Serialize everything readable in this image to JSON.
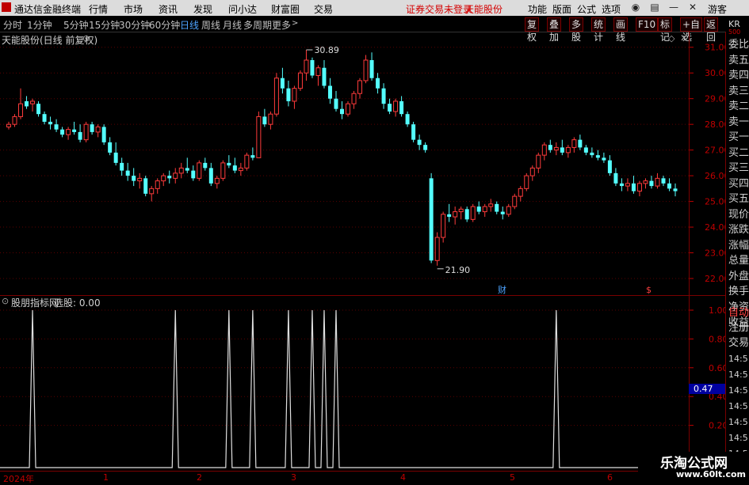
{
  "titlebar": {
    "app_name": "通达信金融终端",
    "menus": [
      "行情",
      "市场",
      "资讯",
      "发现",
      "问小达",
      "财富圈",
      "交易"
    ],
    "notice": "证券交易未登录",
    "stock": "天能股份",
    "right_menus": [
      "功能",
      "版面",
      "公式",
      "选项"
    ],
    "guest": "游客"
  },
  "periodbar": {
    "items": [
      "分时",
      "1分钟",
      "5分钟",
      "15分钟",
      "30分钟",
      "60分钟",
      "日线",
      "周线",
      "月线",
      "多周期",
      "更多"
    ],
    "selected": "日线"
  },
  "toolbar": {
    "buttons": [
      "复权",
      "叠加",
      "多股",
      "统计",
      "画线",
      "F10",
      "标记",
      "+自选",
      "返回"
    ]
  },
  "main_chart": {
    "title": "天能股份(日线 前复权)",
    "y_labels": [
      "31.00",
      "30.00",
      "29.00",
      "28.00",
      "27.00",
      "26.00",
      "25.00",
      "24.00",
      "23.00",
      "22.00"
    ],
    "high_label": "30.89",
    "low_label": "21.90",
    "marker_cai": "财",
    "marker_s": "$"
  },
  "sub_chart": {
    "title": "股朋指标网",
    "indicator": "选股: 0.00",
    "y_labels": [
      "1.00",
      "0.80",
      "0.60",
      "0.40",
      "0.20"
    ],
    "cursor_value": "0.47"
  },
  "right_panel": {
    "items": [
      "委比",
      "卖五",
      "卖四",
      "卖三",
      "卖二",
      "卖一",
      "买一",
      "买二",
      "买三",
      "买四",
      "买五",
      "现价",
      "涨跌",
      "涨幅",
      "总量",
      "外盘",
      "换手",
      "净资",
      "收益",
      "自动",
      "注册",
      "交易",
      "14:5",
      "14:5",
      "14:5",
      "14:5",
      "14:5",
      "14:5",
      "14:5"
    ],
    "header": "KR",
    "header_sub": "500"
  },
  "x_axis": {
    "labels": [
      "2024年",
      "1",
      "2",
      "3",
      "4",
      "5",
      "6"
    ]
  },
  "watermark": {
    "title": "乐淘公式网",
    "url": "www.60lt.com"
  },
  "chart_data": {
    "type": "candlestick",
    "y_range": [
      21.6,
      31.3
    ],
    "candles": [
      [
        27.9,
        28.1,
        27.8,
        28.0
      ],
      [
        28.0,
        28.4,
        27.9,
        28.3
      ],
      [
        28.3,
        29.4,
        28.2,
        28.8
      ],
      [
        28.9,
        29.1,
        28.6,
        28.7
      ],
      [
        28.8,
        29.0,
        28.5,
        28.9
      ],
      [
        28.8,
        28.9,
        28.3,
        28.4
      ],
      [
        28.4,
        28.5,
        28.0,
        28.1
      ],
      [
        28.1,
        28.3,
        27.8,
        28.0
      ],
      [
        28.0,
        28.2,
        27.7,
        27.8
      ],
      [
        27.8,
        27.9,
        27.5,
        27.6
      ],
      [
        27.6,
        27.9,
        27.4,
        27.8
      ],
      [
        27.8,
        28.1,
        27.6,
        27.7
      ],
      [
        27.7,
        28.0,
        27.3,
        27.4
      ],
      [
        27.4,
        28.1,
        27.3,
        28.0
      ],
      [
        28.0,
        28.1,
        27.6,
        27.7
      ],
      [
        27.7,
        28.0,
        27.5,
        27.9
      ],
      [
        27.9,
        28.0,
        27.2,
        27.3
      ],
      [
        27.3,
        27.5,
        26.8,
        26.9
      ],
      [
        26.9,
        27.3,
        26.4,
        26.5
      ],
      [
        26.5,
        26.7,
        26.0,
        26.2
      ],
      [
        26.2,
        26.5,
        25.8,
        26.0
      ],
      [
        26.0,
        26.3,
        25.6,
        25.8
      ],
      [
        25.8,
        26.1,
        25.5,
        25.9
      ],
      [
        25.9,
        26.0,
        25.2,
        25.3
      ],
      [
        25.3,
        25.6,
        25.0,
        25.5
      ],
      [
        25.5,
        25.9,
        25.3,
        25.8
      ],
      [
        25.8,
        26.1,
        25.6,
        26.0
      ],
      [
        26.0,
        26.2,
        25.7,
        25.9
      ],
      [
        25.9,
        26.3,
        25.7,
        26.1
      ],
      [
        26.1,
        26.5,
        25.9,
        26.3
      ],
      [
        26.3,
        26.7,
        26.1,
        26.2
      ],
      [
        26.2,
        26.4,
        25.8,
        25.9
      ],
      [
        25.9,
        26.6,
        25.8,
        26.5
      ],
      [
        26.5,
        26.7,
        26.2,
        26.3
      ],
      [
        26.3,
        26.5,
        25.6,
        25.7
      ],
      [
        25.7,
        26.0,
        25.5,
        25.9
      ],
      [
        25.9,
        26.6,
        25.8,
        26.5
      ],
      [
        26.5,
        26.8,
        26.3,
        26.4
      ],
      [
        26.4,
        26.7,
        26.1,
        26.2
      ],
      [
        26.2,
        26.5,
        26.0,
        26.3
      ],
      [
        26.3,
        26.9,
        26.2,
        26.8
      ],
      [
        26.8,
        27.1,
        26.6,
        26.7
      ],
      [
        26.7,
        28.5,
        26.7,
        28.3
      ],
      [
        28.3,
        28.6,
        27.9,
        28.0
      ],
      [
        28.0,
        28.5,
        27.8,
        28.4
      ],
      [
        28.4,
        30.0,
        28.3,
        29.8
      ],
      [
        29.8,
        30.2,
        29.2,
        29.4
      ],
      [
        29.4,
        29.7,
        28.7,
        28.9
      ],
      [
        28.9,
        29.5,
        28.6,
        29.4
      ],
      [
        29.4,
        30.1,
        29.3,
        30.0
      ],
      [
        30.0,
        30.9,
        29.7,
        30.5
      ],
      [
        30.5,
        30.6,
        29.8,
        29.9
      ],
      [
        29.9,
        30.3,
        29.5,
        30.2
      ],
      [
        30.2,
        30.5,
        29.4,
        29.5
      ],
      [
        29.5,
        29.8,
        28.8,
        29.0
      ],
      [
        29.0,
        29.3,
        28.5,
        28.6
      ],
      [
        28.6,
        28.9,
        28.2,
        28.4
      ],
      [
        28.4,
        28.9,
        28.3,
        28.8
      ],
      [
        28.8,
        29.3,
        28.6,
        29.2
      ],
      [
        29.2,
        29.8,
        29.0,
        29.7
      ],
      [
        29.7,
        30.7,
        29.6,
        30.5
      ],
      [
        30.5,
        30.8,
        29.7,
        29.8
      ],
      [
        29.8,
        30.0,
        29.2,
        29.4
      ],
      [
        29.4,
        29.6,
        28.6,
        28.8
      ],
      [
        28.8,
        29.0,
        28.4,
        28.5
      ],
      [
        28.5,
        29.0,
        28.3,
        28.9
      ],
      [
        28.9,
        29.1,
        28.3,
        28.4
      ],
      [
        28.4,
        28.5,
        27.9,
        28.0
      ],
      [
        28.0,
        28.1,
        27.3,
        27.4
      ],
      [
        27.4,
        27.6,
        27.0,
        27.2
      ],
      [
        27.2,
        27.3,
        26.9,
        27.0
      ],
      [
        25.9,
        26.1,
        22.6,
        22.7
      ],
      [
        22.7,
        23.8,
        22.5,
        23.6
      ],
      [
        23.6,
        24.6,
        23.4,
        24.5
      ],
      [
        24.5,
        24.9,
        24.2,
        24.4
      ],
      [
        24.4,
        24.8,
        24.1,
        24.6
      ],
      [
        24.6,
        24.8,
        24.3,
        24.7
      ],
      [
        24.7,
        24.8,
        24.2,
        24.3
      ],
      [
        24.3,
        24.9,
        24.2,
        24.8
      ],
      [
        24.8,
        25.0,
        24.5,
        24.6
      ],
      [
        24.6,
        24.9,
        24.4,
        24.8
      ],
      [
        24.8,
        25.1,
        24.6,
        24.9
      ],
      [
        24.9,
        25.0,
        24.5,
        24.6
      ],
      [
        24.6,
        24.8,
        24.3,
        24.5
      ],
      [
        24.5,
        24.9,
        24.4,
        24.8
      ],
      [
        24.8,
        25.3,
        24.7,
        25.2
      ],
      [
        25.2,
        25.6,
        25.0,
        25.5
      ],
      [
        25.5,
        26.1,
        25.4,
        26.0
      ],
      [
        26.0,
        26.4,
        25.8,
        26.3
      ],
      [
        26.3,
        26.9,
        26.1,
        26.8
      ],
      [
        26.8,
        27.3,
        26.6,
        27.2
      ],
      [
        27.2,
        27.4,
        26.9,
        27.0
      ],
      [
        27.0,
        27.3,
        26.8,
        27.1
      ],
      [
        27.1,
        27.4,
        26.8,
        26.9
      ],
      [
        26.9,
        27.2,
        26.7,
        27.1
      ],
      [
        27.1,
        27.5,
        26.9,
        27.4
      ],
      [
        27.4,
        27.6,
        27.0,
        27.1
      ],
      [
        27.1,
        27.2,
        26.8,
        26.9
      ],
      [
        26.9,
        27.1,
        26.7,
        26.8
      ],
      [
        26.8,
        27.0,
        26.6,
        26.7
      ],
      [
        26.7,
        26.9,
        26.5,
        26.6
      ],
      [
        26.6,
        26.8,
        26.0,
        26.1
      ],
      [
        26.1,
        26.3,
        25.6,
        25.7
      ],
      [
        25.7,
        25.9,
        25.4,
        25.6
      ],
      [
        25.6,
        25.9,
        25.4,
        25.7
      ],
      [
        25.7,
        26.0,
        25.3,
        25.4
      ],
      [
        25.4,
        25.8,
        25.2,
        25.7
      ],
      [
        25.7,
        25.9,
        25.5,
        25.8
      ],
      [
        25.8,
        26.0,
        25.5,
        25.6
      ],
      [
        25.6,
        26.1,
        25.5,
        25.9
      ],
      [
        25.9,
        26.0,
        25.6,
        25.7
      ],
      [
        25.7,
        25.9,
        25.4,
        25.5
      ],
      [
        25.5,
        25.7,
        25.2,
        25.4
      ]
    ],
    "signal_indices": [
      4,
      28,
      37,
      41,
      47,
      51,
      53,
      55,
      92
    ]
  }
}
